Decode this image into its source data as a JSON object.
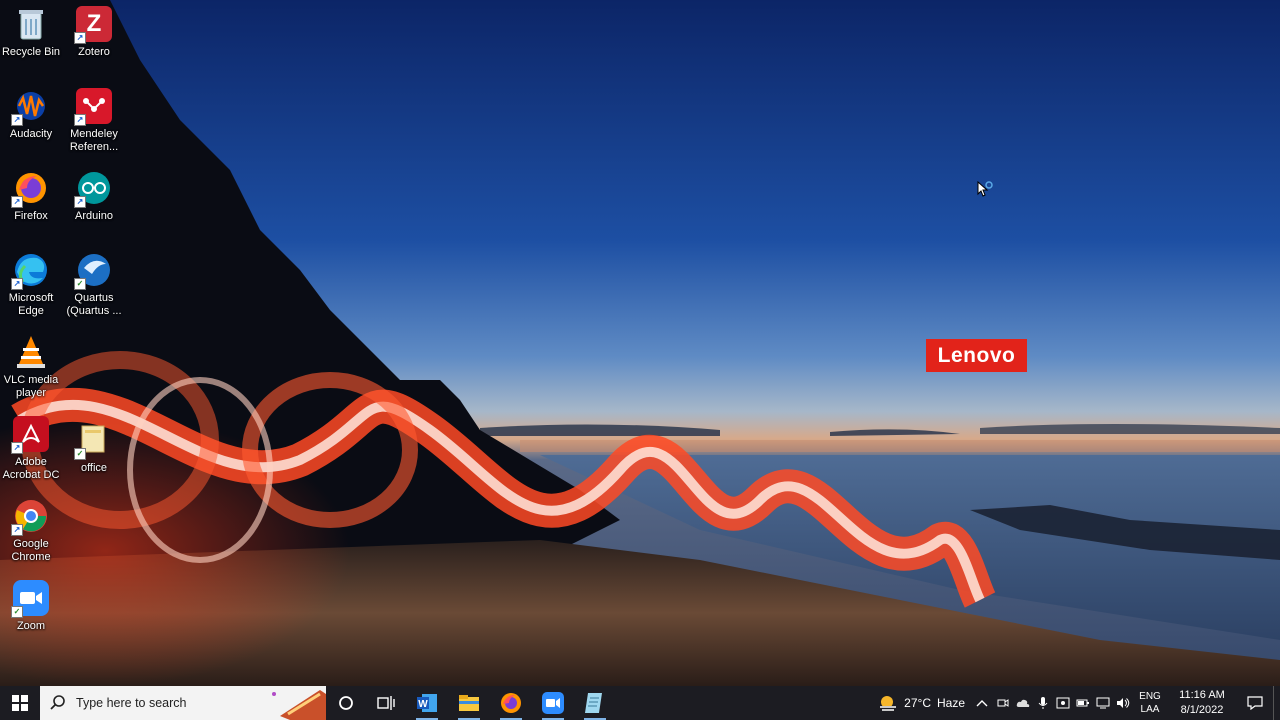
{
  "desktop": {
    "brand": "Lenovo",
    "icons": [
      {
        "label": "Recycle Bin"
      },
      {
        "label": "Zotero"
      },
      {
        "label": "Audacity"
      },
      {
        "label": "Mendeley Referen..."
      },
      {
        "label": "Firefox"
      },
      {
        "label": "Arduino"
      },
      {
        "label": "Microsoft Edge"
      },
      {
        "label": "Quartus (Quartus ..."
      },
      {
        "label": "VLC media player"
      },
      {
        "label": "Adobe Acrobat DC"
      },
      {
        "label": "office"
      },
      {
        "label": "Google Chrome"
      },
      {
        "label": "Zoom"
      }
    ]
  },
  "taskbar": {
    "search_placeholder": "Type here to search",
    "apps": [
      "word-icon",
      "file-explorer-icon",
      "firefox-icon",
      "zoom-icon",
      "notepad-icon"
    ],
    "weather": {
      "temp": "27°C",
      "condition": "Haze"
    },
    "language": {
      "line1": "ENG",
      "line2": "LAA"
    },
    "clock": {
      "time": "11:16 AM",
      "date": "8/1/2022"
    }
  },
  "colors": {
    "taskbar_bg": "#1c1c22",
    "lenovo_red": "#e2231a",
    "sky_top": "#0d2a6e",
    "accent": "#7fb3e6"
  }
}
